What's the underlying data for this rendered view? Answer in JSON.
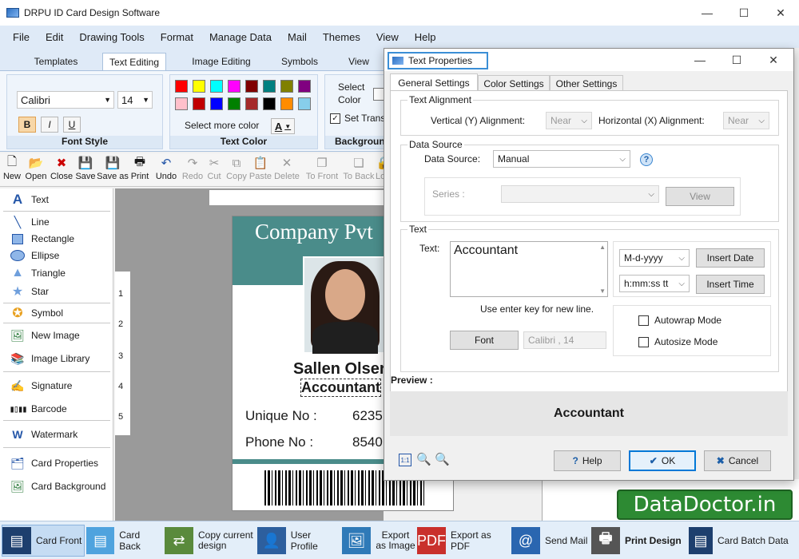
{
  "window": {
    "title": "DRPU ID Card Design Software",
    "minimize": "—",
    "maximize": "☐",
    "close": "✕"
  },
  "menu": [
    "File",
    "Edit",
    "Drawing Tools",
    "Format",
    "Manage Data",
    "Mail",
    "Themes",
    "View",
    "Help"
  ],
  "ribbon_tabs": [
    "Templates",
    "Text Editing",
    "Image Editing",
    "Symbols",
    "View"
  ],
  "font_style": {
    "font": "Calibri",
    "size": "14",
    "bold": "B",
    "italic": "I",
    "underline": "U",
    "label": "Font Style"
  },
  "text_color": {
    "more": "Select more color",
    "a_label": "A",
    "label": "Text Color",
    "swatches": [
      "#ff0000",
      "#ffff00",
      "#00ffff",
      "#ff00ff",
      "#800000",
      "#008080",
      "#808000",
      "#800080",
      "#ffc0cb",
      "#c00000",
      "#0000ff",
      "#008000",
      "#a52a2a",
      "#000000",
      "#ff8c00",
      "#87ceeb"
    ]
  },
  "background": {
    "select": "Select",
    "color": "Color",
    "set_transp": "Set Transp",
    "label": "Backgroun"
  },
  "toolbar": [
    "New",
    "Open",
    "Close",
    "Save",
    "Save as",
    "Print",
    "Undo",
    "Redo",
    "Cut",
    "Copy",
    "Paste",
    "Delete",
    "To Front",
    "To Back",
    "Lo"
  ],
  "tools": [
    "Text",
    "Line",
    "Rectangle",
    "Ellipse",
    "Triangle",
    "Star",
    "Symbol",
    "New Image",
    "Image Library",
    "Signature",
    "Barcode",
    "Watermark",
    "Card Properties",
    "Card Background"
  ],
  "ruler": {
    "v": [
      "1",
      "2",
      "3",
      "4",
      "5"
    ]
  },
  "card": {
    "company": "Company Pvt",
    "name": "Sallen Olser",
    "role": "Accountant",
    "unique_label": "Unique No  :",
    "unique_val": "6235",
    "phone_label": "Phone No  :",
    "phone_val": "8540"
  },
  "bottom": [
    "Card Front",
    "Card Back",
    "Copy current design",
    "User Profile",
    "Export as Image",
    "Export as PDF",
    "Send Mail",
    "Print Design",
    "Card Batch Data"
  ],
  "watermark": "DataDoctor.in",
  "dialog": {
    "title": "Text Properties",
    "tabs": [
      "General Settings",
      "Color Settings",
      "Other Settings"
    ],
    "text_alignment": "Text Alignment",
    "vertical_label": "Vertical (Y) Alignment:",
    "vertical_val": "Near",
    "horizontal_label": "Horizontal (X) Alignment:",
    "horizontal_val": "Near",
    "data_source_group": "Data Source",
    "data_source_label": "Data Source:",
    "data_source_val": "Manual",
    "help_q": "?",
    "series_label": "Series  :",
    "view_btn": "View",
    "text_group": "Text",
    "text_label": "Text:",
    "text_value": "Accountant",
    "date_format": "M-d-yyyy",
    "insert_date": "Insert Date",
    "time_format": "h:mm:ss tt",
    "insert_time": "Insert Time",
    "enter_hint": "Use enter key for new line.",
    "font_btn": "Font",
    "font_val": "Calibri , 14",
    "autowrap": "Autowrap Mode",
    "autosize": "Autosize Mode",
    "preview_label": "Preview :",
    "preview_text": "Accountant",
    "zoom_11": "1:1",
    "help_btn": "Help",
    "ok_btn": "OK",
    "cancel_btn": "Cancel"
  }
}
